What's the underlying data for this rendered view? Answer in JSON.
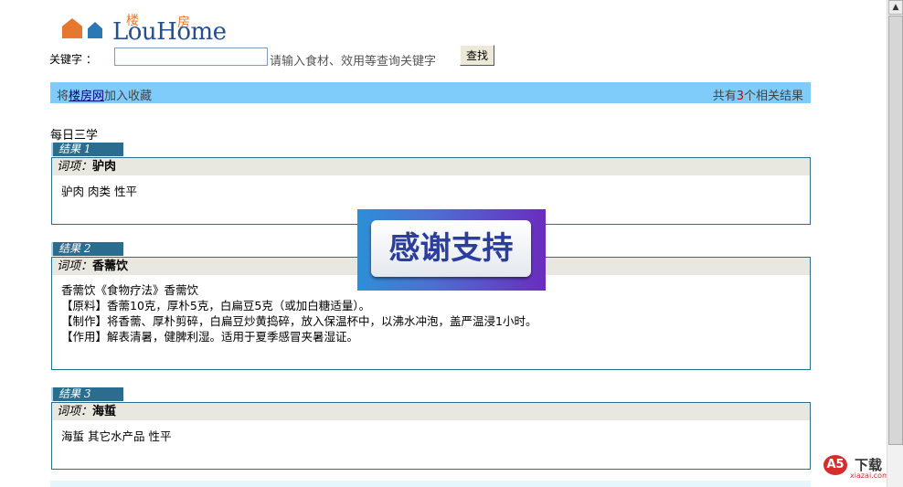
{
  "logo": {
    "brand": "LouHome",
    "cn_left": "楼",
    "cn_right": "房"
  },
  "search": {
    "label": "关键字 ：",
    "value": "",
    "hint": "请输入食材、效用等查询关键字",
    "button": "查找"
  },
  "topbar": {
    "prefix": "将",
    "link": "楼房网",
    "suffix": "加入收藏",
    "result_prefix": "共有",
    "result_count": "3",
    "result_suffix": "个相关结果"
  },
  "section_title": "每日三学",
  "term_label": "词项：",
  "results": [
    {
      "tag": "结果 1",
      "term": "驴肉",
      "lines": [
        "驴肉 肉类 性平"
      ]
    },
    {
      "tag": "结果 2",
      "term": "香薷饮",
      "lines": [
        "香薷饮《食物疗法》香薷饮",
        "【原料】香薷10克，厚朴5克，白扁豆5克（或加白糖适量）。",
        "【制作】将香薷、厚朴剪碎，白扁豆炒黄捣碎，放入保温杯中，以沸水冲泡，盖严温浸1小时。",
        "【作用】解表清暑，健脾利湿。适用于夏季感冒夹暑湿证。"
      ]
    },
    {
      "tag": "结果 3",
      "term": "海蜇",
      "lines": [
        "海蜇 其它水产品 性平"
      ]
    }
  ],
  "overlay": {
    "thanks_text": "感谢支持"
  },
  "watermark": {
    "circle": "A5",
    "title": "下载",
    "url": "xiazai.com"
  },
  "colors": {
    "topbar_bg": "#7fcbf9",
    "tag_bg": "#2b6d8e",
    "term_header_bg": "#e8e8e0",
    "count_red": "#cc0000"
  }
}
